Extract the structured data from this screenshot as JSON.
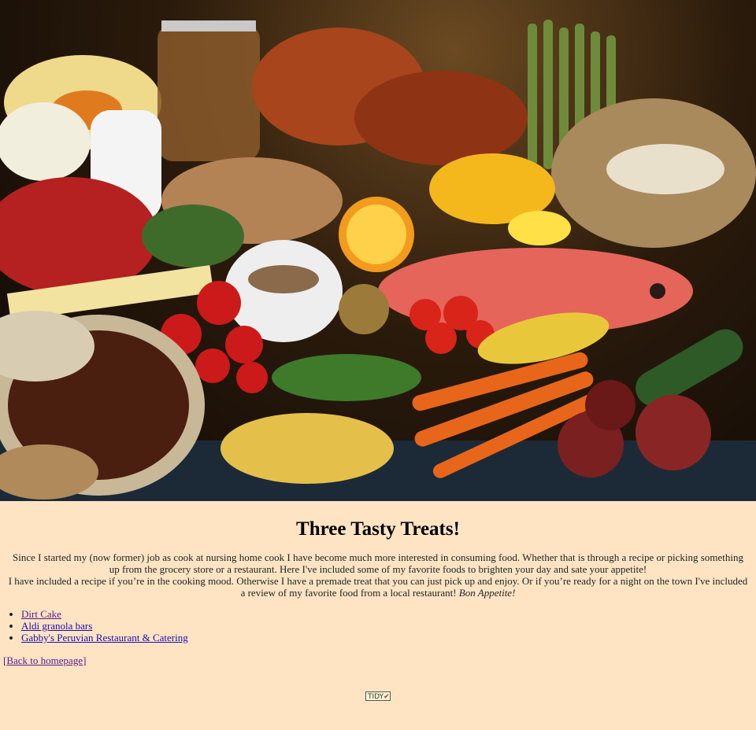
{
  "page": {
    "title": "Three Tasty Treats!",
    "intro_line1": "Since I started my (now former) job as cook at nursing home cook I have become much more interested in consuming food. Whether that is through a recipe or picking something up from the grocery store or a restaurant. Here I've included some of my favorite foods to brighten your day and sate your appetite!",
    "intro_line2": "I have included a recipe if you’re in the cooking mood. Otherwise I have a premade treat that you can just pick up and enjoy. Or if you’re ready for a night on the town I've included a review of my favorite food from a local restaurant!",
    "intro_em": "Bon Appetite!"
  },
  "links": [
    {
      "label": "Dirt Cake"
    },
    {
      "label": "Aldi granola bars"
    },
    {
      "label": "Gabby's Peruvian Restaurant & Catering"
    }
  ],
  "back_link": {
    "open": "[",
    "label": "Back to homepage",
    "close": "]"
  },
  "badge": {
    "text": "TIDY",
    "mark": "✔"
  },
  "colors": {
    "background": "#ffe4c4",
    "link": "#1a0dab",
    "visited": "#551a8b"
  }
}
